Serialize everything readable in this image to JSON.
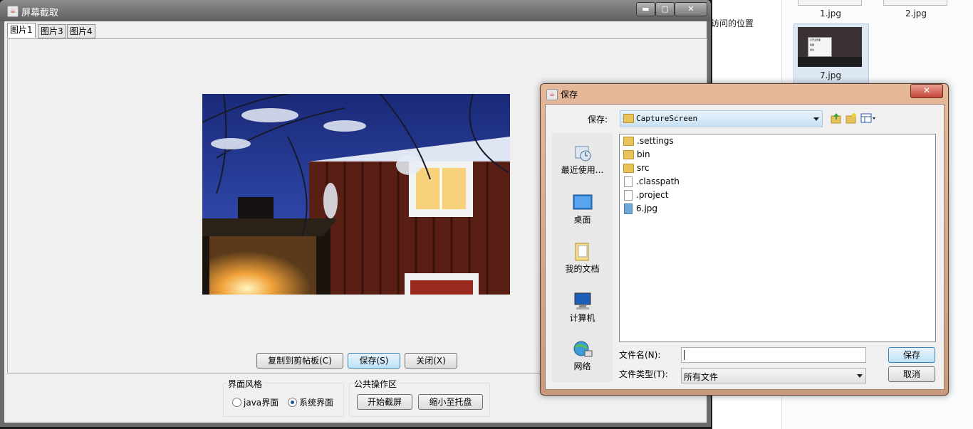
{
  "explorer": {
    "left_text_1": "访问的位置",
    "left_text_2": "",
    "thumbs": [
      {
        "label": "1.jpg"
      },
      {
        "label": "2.jpg"
      },
      {
        "label": "7.jpg"
      }
    ],
    "thumb7_menu": [
      "打开主界面",
      "截图",
      "退出"
    ]
  },
  "main_window": {
    "title": "屏幕截取",
    "java_icon": "java-icon",
    "minimize_glyph": "▬",
    "maximize_glyph": "▢",
    "close_glyph": "✕",
    "tabs": [
      {
        "label": "图片1",
        "active": true
      },
      {
        "label": "图片3",
        "active": false
      },
      {
        "label": "图片4",
        "active": false
      }
    ],
    "buttons": {
      "copy": "复制到剪帖板(C)",
      "save": "保存(S)",
      "close": "关闭(X)"
    },
    "style_group": {
      "title": "界面风格",
      "option_java": "java界面",
      "option_system": "系统界面",
      "selected": "系统界面"
    },
    "ops_group": {
      "title": "公共操作区",
      "start_capture": "开始截屏",
      "minimize_tray": "缩小至托盘"
    }
  },
  "save_dialog": {
    "title": "保存",
    "close_glyph": "✕",
    "save_in_label": "保存:",
    "save_in_value": "CaptureScreen",
    "places": [
      {
        "label": "最近使用...",
        "icon": "recent-icon"
      },
      {
        "label": "桌面",
        "icon": "desktop-icon"
      },
      {
        "label": "我的文档",
        "icon": "documents-icon"
      },
      {
        "label": "计算机",
        "icon": "computer-icon"
      },
      {
        "label": "网络",
        "icon": "network-icon"
      }
    ],
    "files": [
      {
        "name": ".settings",
        "type": "folder"
      },
      {
        "name": "bin",
        "type": "folder"
      },
      {
        "name": "src",
        "type": "folder"
      },
      {
        "name": ".classpath",
        "type": "file"
      },
      {
        "name": ".project",
        "type": "file"
      },
      {
        "name": "6.jpg",
        "type": "image"
      }
    ],
    "filename_label": "文件名(N):",
    "filename_value": "",
    "filetype_label": "文件类型(T):",
    "filetype_value": "所有文件",
    "save_button": "保存",
    "cancel_button": "取消"
  },
  "colors": {
    "dialog_frame": "#d7a889",
    "title_dark": "#6b6b6b",
    "focus_button": "#bee2f9",
    "folder": "#e8c35a"
  }
}
